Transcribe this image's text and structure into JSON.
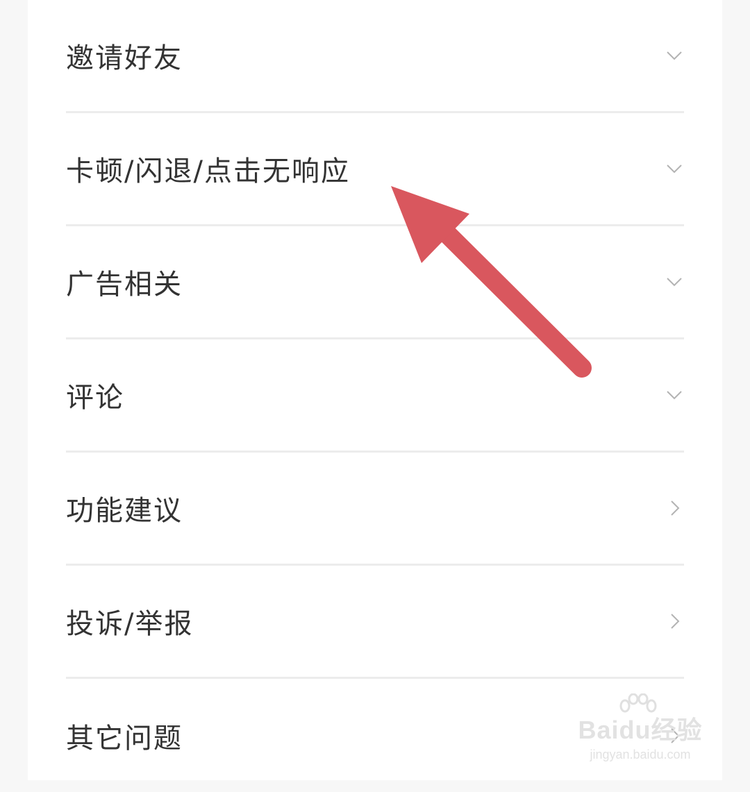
{
  "menu": {
    "items": [
      {
        "label": "邀请好友",
        "icon": "chevron-down-icon"
      },
      {
        "label": "卡顿/闪退/点击无响应",
        "icon": "chevron-down-icon"
      },
      {
        "label": "广告相关",
        "icon": "chevron-down-icon"
      },
      {
        "label": "评论",
        "icon": "chevron-down-icon"
      },
      {
        "label": "功能建议",
        "icon": "chevron-right-icon"
      },
      {
        "label": "投诉/举报",
        "icon": "chevron-right-icon"
      },
      {
        "label": "其它问题",
        "icon": "chevron-right-icon"
      }
    ]
  },
  "annotation": {
    "arrow_color": "#d9575e"
  },
  "watermark": {
    "brand": "Baidu经验",
    "url": "jingyan.baidu.com"
  }
}
